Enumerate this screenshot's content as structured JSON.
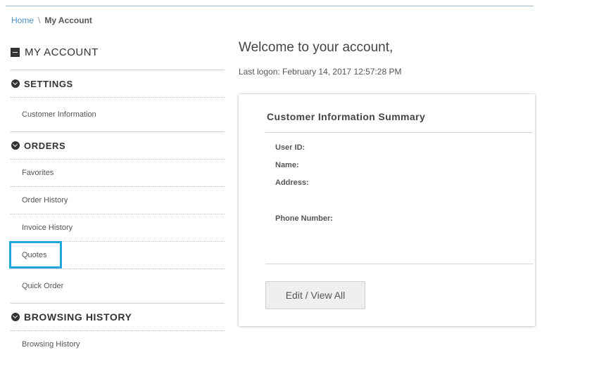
{
  "breadcrumb": {
    "home": "Home",
    "separator": "\\",
    "current": "My Account"
  },
  "sidebar": {
    "title": "MY ACCOUNT",
    "sections": [
      {
        "label": "SETTINGS",
        "items": [
          "Customer Information"
        ]
      },
      {
        "label": "ORDERS",
        "items": [
          "Favorites",
          "Order History",
          "Invoice History",
          "Quotes",
          "Quick Order"
        ]
      },
      {
        "label": "BROWSING HISTORY",
        "items": [
          "Browsing History"
        ]
      }
    ],
    "highlighted_item": "Quotes"
  },
  "main": {
    "welcome": "Welcome to your account,",
    "last_logon": "Last logon: February 14, 2017 12:57:28 PM"
  },
  "summary": {
    "title": "Customer Information Summary",
    "fields": {
      "user_id": "User ID:",
      "name": "Name:",
      "address": "Address:",
      "phone": "Phone Number:"
    },
    "edit_button": "Edit / View All"
  },
  "colors": {
    "highlight": "#1fa7de",
    "link": "#4b8ec4"
  }
}
